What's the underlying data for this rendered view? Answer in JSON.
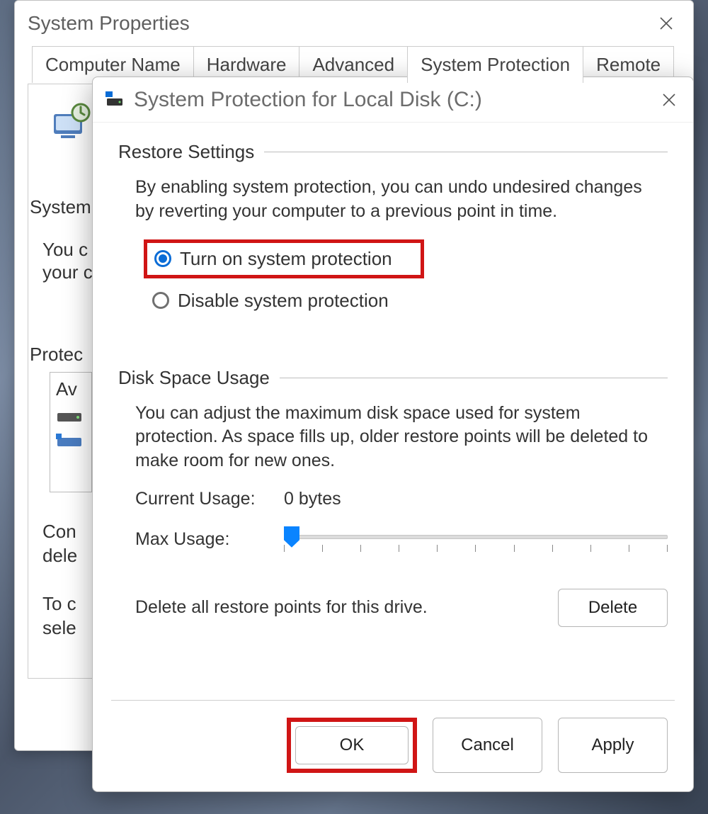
{
  "parentWindow": {
    "title": "System Properties",
    "tabs": [
      "Computer Name",
      "Hardware",
      "Advanced",
      "System Protection",
      "Remote"
    ],
    "activeTab": "System Protection",
    "fragments": {
      "system_label": "System",
      "you_c": "You c",
      "your_c": "your c",
      "protec": "Protec",
      "av": "Av",
      "con": "Con",
      "dele": "dele",
      "to_c": "To c",
      "sele": "sele"
    }
  },
  "dialog": {
    "title": "System Protection for Local Disk (C:)",
    "restore": {
      "heading": "Restore Settings",
      "description": "By enabling system protection, you can undo undesired changes by reverting your computer to a previous point in time.",
      "option_on": "Turn on system protection",
      "option_off": "Disable system protection",
      "selected": "on"
    },
    "disk": {
      "heading": "Disk Space Usage",
      "description": "You can adjust the maximum disk space used for system protection. As space fills up, older restore points will be deleted to make room for new ones.",
      "current_label": "Current Usage:",
      "current_value": "0 bytes",
      "max_label": "Max Usage:",
      "delete_text": "Delete all restore points for this drive.",
      "delete_button": "Delete"
    },
    "buttons": {
      "ok": "OK",
      "cancel": "Cancel",
      "apply": "Apply"
    }
  }
}
